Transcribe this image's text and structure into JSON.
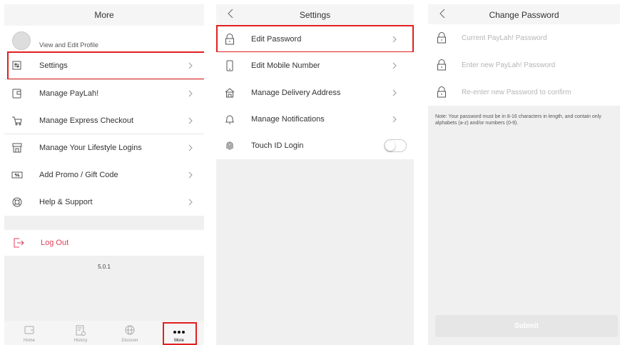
{
  "more": {
    "title": "More",
    "profile_label": "View and Edit Profile",
    "items": [
      {
        "label": "Settings",
        "icon": "settings-icon"
      },
      {
        "label": "Manage PayLah!",
        "icon": "paylah-icon"
      },
      {
        "label": "Manage Express Checkout",
        "icon": "cart-icon"
      },
      {
        "label": "Manage Your Lifestyle Logins",
        "icon": "store-icon"
      },
      {
        "label": "Add Promo / Gift Code",
        "icon": "promo-icon"
      },
      {
        "label": "Help & Support",
        "icon": "lifebuoy-icon"
      }
    ],
    "logout_label": "Log Out",
    "version": "5.0.1",
    "tabs": [
      {
        "label": "Home",
        "icon": "wallet-icon"
      },
      {
        "label": "History",
        "icon": "history-icon"
      },
      {
        "label": "Discover",
        "icon": "globe-icon"
      },
      {
        "label": "More",
        "icon": "more-dots-icon"
      }
    ]
  },
  "settings": {
    "title": "Settings",
    "items": [
      {
        "label": "Edit Password",
        "icon": "lock-icon"
      },
      {
        "label": "Edit Mobile Number",
        "icon": "phone-icon"
      },
      {
        "label": "Manage Delivery Address",
        "icon": "house-icon"
      },
      {
        "label": "Manage Notifications",
        "icon": "bell-icon"
      }
    ],
    "touch_id_label": "Touch ID Login",
    "touch_id_enabled": false
  },
  "change_password": {
    "title": "Change Password",
    "fields": [
      {
        "placeholder": "Current PayLah! Password",
        "value": ""
      },
      {
        "placeholder": "Enter new PayLah! Password",
        "value": ""
      },
      {
        "placeholder": "Re-enter new Password to confirm",
        "value": ""
      }
    ],
    "note": "Note: Your password must be in 8-16 characters in length, and contain only alphabets (a-z) and/or numbers (0-9).",
    "submit_label": "Submit"
  },
  "colors": {
    "highlight": "#e02020",
    "logout": "#e0405a",
    "navbar_bg": "#f5f5f5",
    "band_bg": "#f0f0f0"
  }
}
